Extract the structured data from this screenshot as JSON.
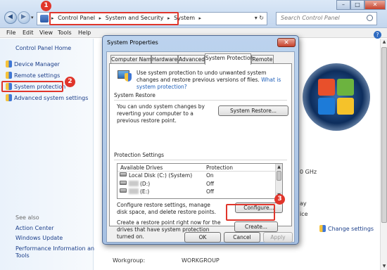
{
  "address": {
    "crumbs": [
      "Control Panel",
      "System and Security",
      "System"
    ]
  },
  "search": {
    "placeholder": "Search Control Panel"
  },
  "window_buttons": {
    "min": "–",
    "max": "□",
    "close": "✕"
  },
  "menu": [
    "File",
    "Edit",
    "View",
    "Tools",
    "Help"
  ],
  "help_glyph": "?",
  "sidebar": {
    "home": "Control Panel Home",
    "items": [
      {
        "label": "Device Manager",
        "icon": "shield-icon"
      },
      {
        "label": "Remote settings",
        "icon": "shield-icon"
      },
      {
        "label": "System protection",
        "icon": "shield-icon"
      },
      {
        "label": "Advanced system settings",
        "icon": "shield-icon"
      }
    ],
    "see_also": "See also",
    "see_also_items": [
      "Action Center",
      "Windows Update",
      "Performance Information and",
      "Tools"
    ]
  },
  "content": {
    "ghz_fragment": "0 GHz",
    "hz_fragment": "ay",
    "ice_fragment": "ice",
    "change_settings": "Change settings",
    "workgroup_label": "Workgroup:",
    "workgroup_value": "WORKGROUP"
  },
  "dialog": {
    "title": "System Properties",
    "close": "✕",
    "tabs": [
      "Computer Name",
      "Hardware",
      "Advanced",
      "System Protection",
      "Remote"
    ],
    "active_tab": "System Protection",
    "intro_text": "Use system protection to undo unwanted system changes and restore previous versions of files.",
    "intro_link": "What is system protection?",
    "restore_group": "System Restore",
    "restore_text": "You can undo system changes by reverting your computer to a previous restore point.",
    "restore_button": "System Restore...",
    "protection_group": "Protection Settings",
    "drives_headers": [
      "Available Drives",
      "Protection"
    ],
    "drives": [
      {
        "name": "Local Disk (C:) (System)",
        "protection": "On"
      },
      {
        "name": "(D:)",
        "protection": "Off"
      },
      {
        "name": "(E:)",
        "protection": "Off"
      }
    ],
    "configure_text": "Configure restore settings, manage disk space, and delete restore points.",
    "configure_button": "Configure...",
    "create_text": "Create a restore point right now for the drives that have system protection turned on.",
    "create_button": "Create...",
    "ok": "OK",
    "cancel": "Cancel",
    "apply": "Apply"
  },
  "badges": [
    "1",
    "2",
    "3"
  ],
  "colors": {
    "highlight": "#e0352b",
    "link": "#1c3f8a"
  }
}
